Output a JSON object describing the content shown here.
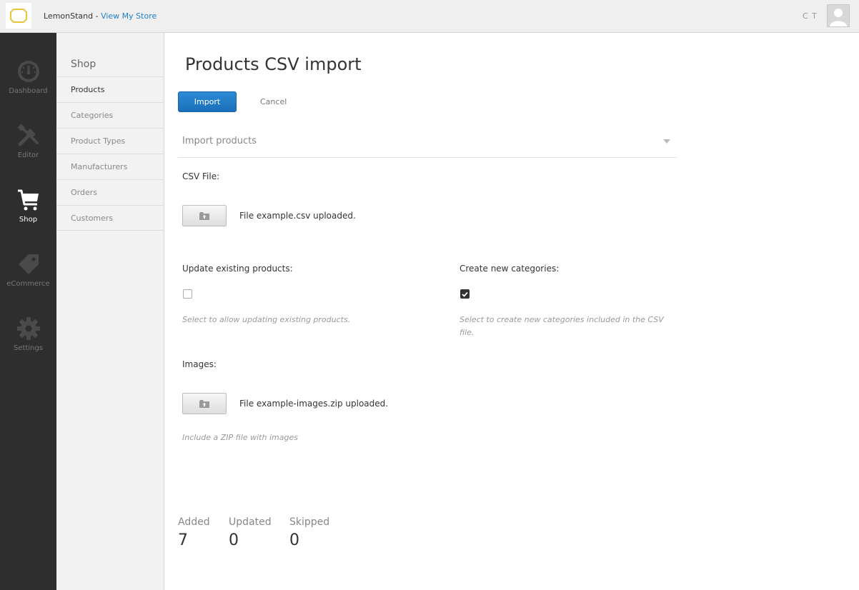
{
  "header": {
    "store_name": "LemonStand - ",
    "view_store_link": "View My Store",
    "user_initials": "C T"
  },
  "main_nav": {
    "items": [
      {
        "label": "Dashboard",
        "icon": "gauge-icon"
      },
      {
        "label": "Editor",
        "icon": "tools-icon"
      },
      {
        "label": "Shop",
        "icon": "cart-icon"
      },
      {
        "label": "eCommerce",
        "icon": "tag-icon"
      },
      {
        "label": "Settings",
        "icon": "gear-icon"
      }
    ],
    "active": "Shop"
  },
  "sub_nav": {
    "title": "Shop",
    "items": [
      {
        "label": "Products"
      },
      {
        "label": "Categories"
      },
      {
        "label": "Product Types"
      },
      {
        "label": "Manufacturers"
      },
      {
        "label": "Orders"
      },
      {
        "label": "Customers"
      }
    ],
    "active": "Products"
  },
  "page": {
    "title": "Products CSV import",
    "import_button": "Import",
    "cancel_link": "Cancel",
    "section_title": "Import products"
  },
  "form": {
    "csv_file": {
      "label": "CSV File:",
      "status": "File example.csv uploaded."
    },
    "update_existing": {
      "label": "Update existing products:",
      "checked": false,
      "hint": "Select to allow updating existing products."
    },
    "create_categories": {
      "label": "Create new categories:",
      "checked": true,
      "hint_line1": "Select to create new categories included in the CSV",
      "hint_line2": "file."
    },
    "images": {
      "label": "Images:",
      "status": "File example-images.zip uploaded.",
      "hint": "Include a ZIP file with images"
    }
  },
  "results": {
    "added_label": "Added",
    "added_value": "7",
    "updated_label": "Updated",
    "updated_value": "0",
    "skipped_label": "Skipped",
    "skipped_value": "0"
  },
  "colors": {
    "accent": "#1f7fc6",
    "nav_bg": "#2e2e2e",
    "logo": "#e8c53a"
  }
}
